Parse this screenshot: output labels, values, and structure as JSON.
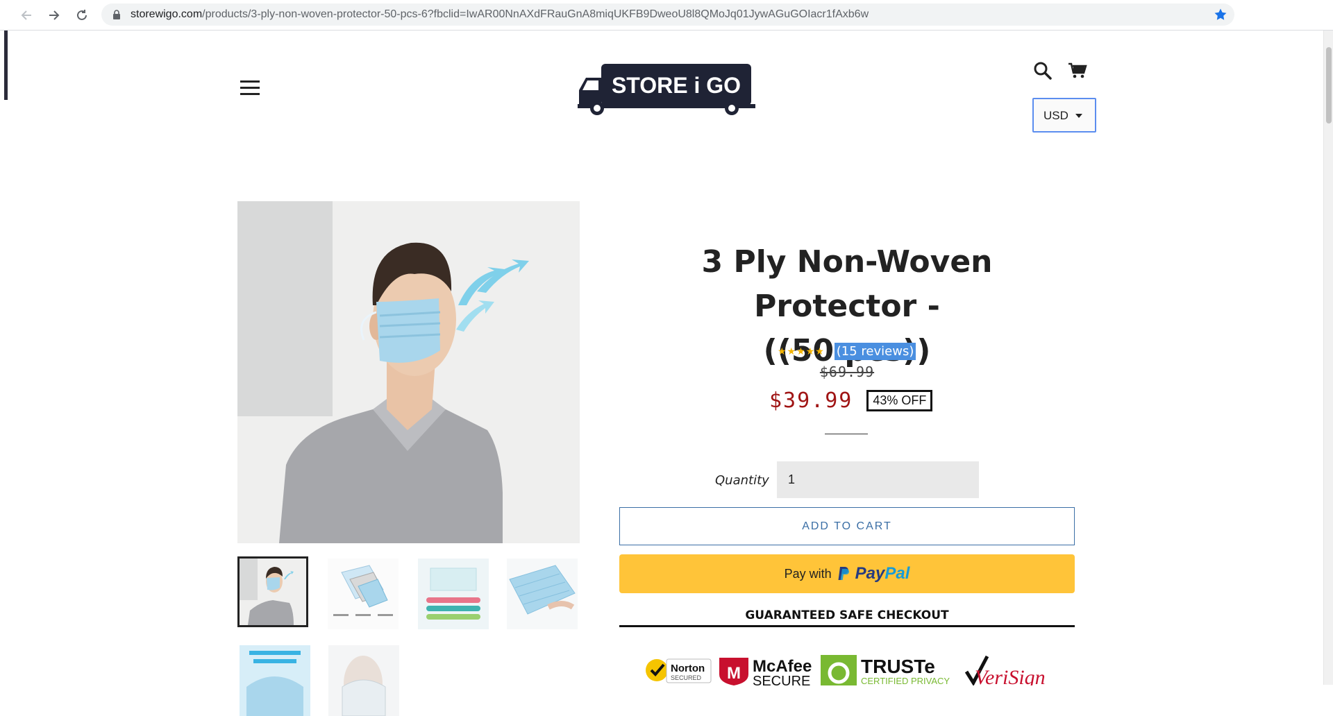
{
  "browser": {
    "url_host": "storewigo.com",
    "url_path": "/products/3-ply-non-woven-protector-50-pcs-6?fbclid=IwAR00NnAXdFRauGnA8miqUKFB9DweoU8l8QMoJq01JywAGuGOIacr1fAxb6w"
  },
  "header": {
    "logo_text": "STORE i GO",
    "currency": "USD"
  },
  "product": {
    "title_line1": "3 Ply Non-Woven Protector -",
    "title_line2": "((50 pcs))",
    "stars": "★★★★★",
    "rating_value": 5,
    "reviews": "(15 reviews)",
    "compare_price": "$69.99",
    "price": "$39.99",
    "discount_badge": "43% OFF",
    "quantity_label": "Quantity",
    "quantity_value": "1",
    "add_to_cart": "ADD TO CART",
    "paypal_prefix": "Pay with",
    "paypal_pay": "Pay",
    "paypal_pal": "Pal",
    "safe_checkout": "GUARANTEED SAFE CHECKOUT"
  },
  "thumbnails": [
    {
      "name": "man-wearing-mask"
    },
    {
      "name": "mask-layers-diagram"
    },
    {
      "name": "mask-features-infographic"
    },
    {
      "name": "mask-stack"
    },
    {
      "name": "three-dimensional-breathing-space"
    },
    {
      "name": "mask-nose-clip"
    }
  ],
  "trust_badges": {
    "norton": "Norton",
    "norton_sub": "SECURED",
    "mcafee": "McAfee",
    "mcafee_sub": "SECURE",
    "truste": "TRUSTe",
    "truste_sub": "CERTIFIED PRIVACY",
    "verisign": "VeriSign"
  },
  "colors": {
    "price": "#a01515",
    "reviews_highlight": "#4a8fe0",
    "paypal_yellow": "#ffc439",
    "accent_blue": "#3a6ea5"
  }
}
